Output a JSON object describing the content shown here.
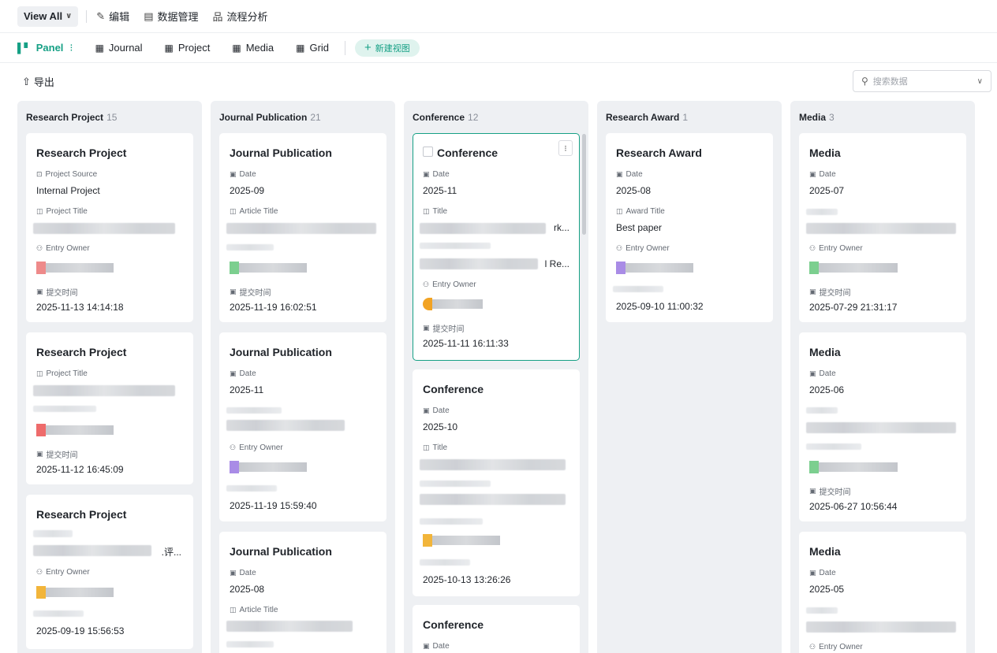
{
  "toolbar": {
    "view_all": "View All",
    "edit": "编辑",
    "data_manage": "数据管理",
    "flow_analysis": "流程分析"
  },
  "tabs": [
    {
      "label": "Panel",
      "icon": "kanban-icon"
    },
    {
      "label": "Journal",
      "icon": "table-icon"
    },
    {
      "label": "Project",
      "icon": "table-icon"
    },
    {
      "label": "Media",
      "icon": "table-icon"
    },
    {
      "label": "Grid",
      "icon": "table-icon"
    }
  ],
  "new_view": "新建视图",
  "export_label": "导出",
  "search": {
    "placeholder": "搜索数据"
  },
  "accent_color": "#16a085",
  "columns": [
    {
      "title": "Research Project",
      "count": "15",
      "cards": [
        {
          "title": "Research Project",
          "f1_label": "Project Source",
          "f1_value": "Internal Project",
          "f2_label": "Project Title",
          "f3_label": "Entry Owner",
          "f4_label": "提交时间",
          "f4_value": "2025-11-13 14:14:18"
        },
        {
          "title": "Research Project",
          "f1_label": "Project Title",
          "f4_label": "提交时间",
          "f4_value": "2025-11-12 16:45:09"
        },
        {
          "title": "Research Project",
          "f3_label": "Entry Owner",
          "f4_value": "2025-09-19 15:56:53",
          "trail": ".评..."
        }
      ]
    },
    {
      "title": "Journal Publication",
      "count": "21",
      "cards": [
        {
          "title": "Journal Publication",
          "f1_label": "Date",
          "f1_value": "2025-09",
          "f2_label": "Article Title",
          "f4_label": "提交时间",
          "f4_value": "2025-11-19 16:02:51"
        },
        {
          "title": "Journal Publication",
          "f1_label": "Date",
          "f1_value": "2025-11",
          "f3_label": "Entry Owner",
          "f4_value": "2025-11-19 15:59:40"
        },
        {
          "title": "Journal Publication",
          "f1_label": "Date",
          "f1_value": "2025-08",
          "f2_label": "Article Title"
        }
      ]
    },
    {
      "title": "Conference",
      "count": "12",
      "cards": [
        {
          "title": "Conference",
          "f1_label": "Date",
          "f1_value": "2025-11",
          "f2_label": "Title",
          "f3_label": "Entry Owner",
          "f4_label": "提交时间",
          "f4_value": "2025-11-11 16:11:33",
          "trail1": "rk...",
          "trail2": "l Re..."
        },
        {
          "title": "Conference",
          "f1_label": "Date",
          "f1_value": "2025-10",
          "f2_label": "Title",
          "f4_value": "2025-10-13 13:26:26"
        },
        {
          "title": "Conference",
          "f1_label": "Date"
        }
      ]
    },
    {
      "title": "Research Award",
      "count": "1",
      "cards": [
        {
          "title": "Research Award",
          "f1_label": "Date",
          "f1_value": "2025-08",
          "f2_label": "Award Title",
          "f2_value": "Best paper",
          "f3_label": "Entry Owner",
          "f4_value": "2025-09-10 11:00:32"
        }
      ]
    },
    {
      "title": "Media",
      "count": "3",
      "cards": [
        {
          "title": "Media",
          "f1_label": "Date",
          "f1_value": "2025-07",
          "f3_label": "Entry Owner",
          "f4_label": "提交时间",
          "f4_value": "2025-07-29 21:31:17"
        },
        {
          "title": "Media",
          "f1_label": "Date",
          "f1_value": "2025-06",
          "f4_label": "提交时间",
          "f4_value": "2025-06-27 10:56:44"
        },
        {
          "title": "Media",
          "f1_label": "Date",
          "f1_value": "2025-05",
          "f3_label": "Entry Owner"
        }
      ]
    }
  ]
}
